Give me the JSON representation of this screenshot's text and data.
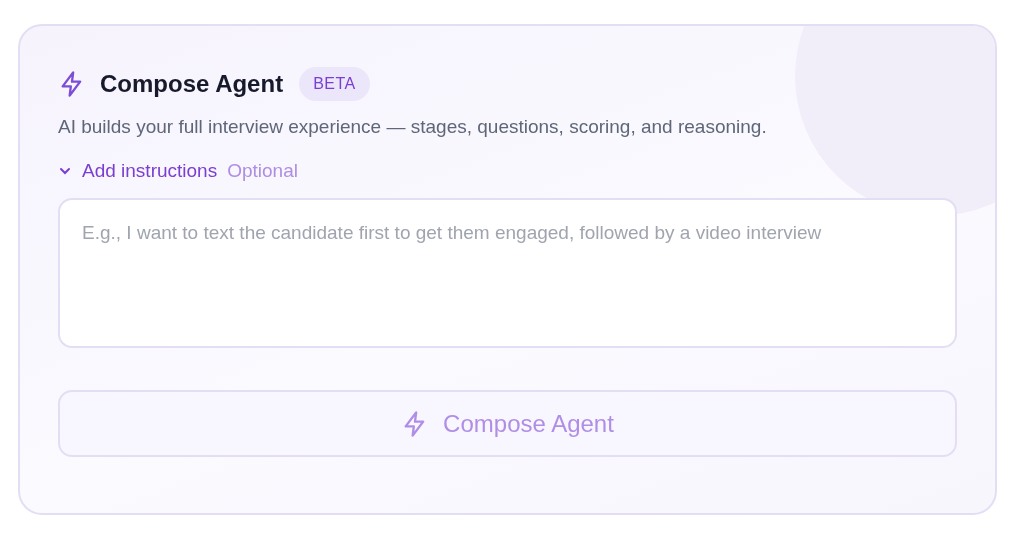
{
  "card": {
    "title": "Compose Agent",
    "badge": "BETA",
    "description": "AI builds your full interview experience — stages, questions, scoring, and reasoning.",
    "instructions_toggle": {
      "label": "Add instructions",
      "hint": "Optional",
      "expanded": true
    },
    "instructions_field": {
      "placeholder": "E.g., I want to text the candidate first to get them engaged, followed by a video interview"
    },
    "compose_button": {
      "label": "Compose Agent",
      "disabled": true
    }
  }
}
